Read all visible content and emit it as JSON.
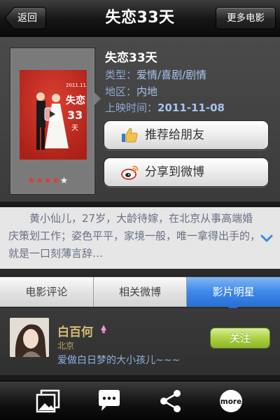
{
  "navbar": {
    "back_label": "返回",
    "title": "失恋33天",
    "more_label": "更多电影"
  },
  "movie": {
    "name": "失恋33天",
    "genre_label": "类型：",
    "genre_value": "爱情/喜剧/剧情",
    "region_label": "地区：",
    "region_value": "内地",
    "release_label": "上映时间：",
    "release_value": "2011-11-08",
    "rating_stars": 4,
    "rating_max": 5,
    "poster_text": {
      "date": "2011.11.8",
      "title": "失恋33天",
      "icon": "play-icon"
    }
  },
  "actions": {
    "recommend_label": "推荐给朋友",
    "recommend_icon": "thumbs-up-icon",
    "share_label": "分享到微博",
    "share_icon": "weibo-icon"
  },
  "description": {
    "text": "黄小仙儿，27岁，大龄待嫁，在北京从事高端婚庆策划工作；姿色平平，家境一般，唯一拿得出手的，就是一口刻薄言辞…",
    "expand_icon": "chevron-down-icon"
  },
  "tabs": [
    {
      "label": "电影评论",
      "active": false
    },
    {
      "label": "相关微博",
      "active": false
    },
    {
      "label": "影片明星",
      "active": true
    }
  ],
  "user": {
    "name": "白百何",
    "gender_icon": "female-icon",
    "city": "北京",
    "bio": "爱做白日梦的大小孩儿~~~",
    "follow_label": "关注"
  },
  "toolbar": {
    "icons": [
      "photos-icon",
      "comment-icon",
      "share-icon",
      "more-icon"
    ],
    "more_label": "more"
  },
  "colors": {
    "accent_blue": "#2a6fd6",
    "link_blue": "#a9c2ee",
    "follow_green": "#a8cf3f",
    "name_gold": "#d7bd73",
    "star_red": "#e03a3a"
  }
}
